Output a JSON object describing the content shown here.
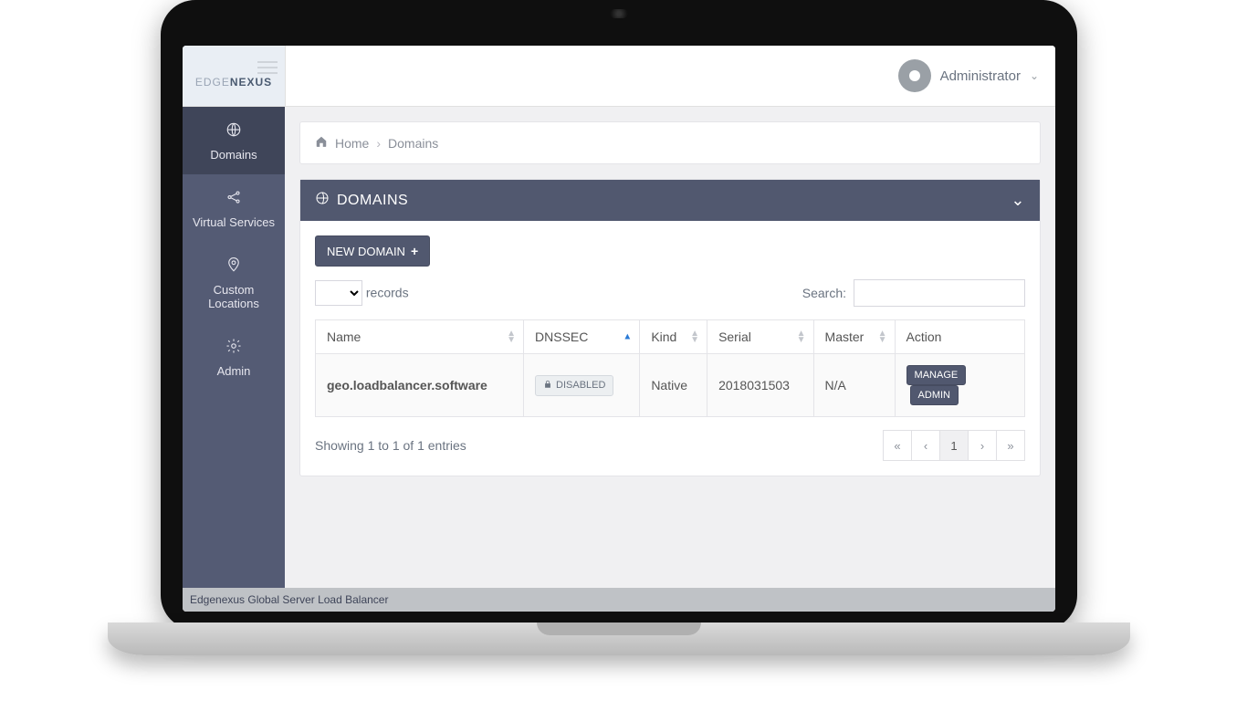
{
  "brand": {
    "part1": "EDGE",
    "part2": "NEXUS"
  },
  "user": {
    "name": "Administrator"
  },
  "sidebar": {
    "items": [
      {
        "label": "Domains"
      },
      {
        "label": "Virtual Services"
      },
      {
        "label": "Custom Locations"
      },
      {
        "label": "Admin"
      }
    ]
  },
  "breadcrumb": {
    "home": "Home",
    "current": "Domains"
  },
  "panel": {
    "title": "DOMAINS",
    "new_domain": "NEW DOMAIN",
    "records_label": "records",
    "search_label": "Search:",
    "columns": {
      "name": "Name",
      "dnssec": "DNSSEC",
      "kind": "Kind",
      "serial": "Serial",
      "master": "Master",
      "action": "Action"
    },
    "rows": [
      {
        "name": "geo.loadbalancer.software",
        "dnssec": "DISABLED",
        "kind": "Native",
        "serial": "2018031503",
        "master": "N/A",
        "manage": "MANAGE",
        "admin": "ADMIN"
      }
    ],
    "info": "Showing 1 to 1 of 1 entries",
    "page": "1"
  },
  "footer": "Edgenexus Global Server Load Balancer"
}
